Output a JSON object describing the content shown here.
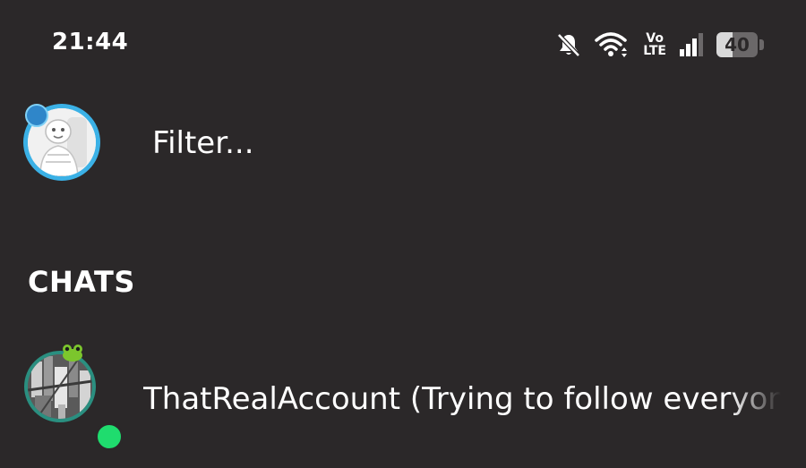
{
  "status_bar": {
    "time": "21:44",
    "icons": [
      "notifications-muted-icon",
      "wifi-icon",
      "volte-icon",
      "signal-icon",
      "battery-icon"
    ],
    "volte_top": "Vo",
    "volte_bottom": "LTE",
    "battery_level": "40",
    "battery_fraction": 0.4
  },
  "filter": {
    "placeholder": "Filter..."
  },
  "sections": {
    "chats_title": "CHATS"
  },
  "chats": [
    {
      "name": "ThatRealAccount (Trying to follow everyone",
      "online": true,
      "status_color": "#1fdc6e",
      "ring_color": "#2a8f80"
    }
  ],
  "colors": {
    "background": "#2b2829",
    "text": "#ffffff",
    "profile_ring": "#3bb1e6",
    "online": "#1fdc6e"
  }
}
